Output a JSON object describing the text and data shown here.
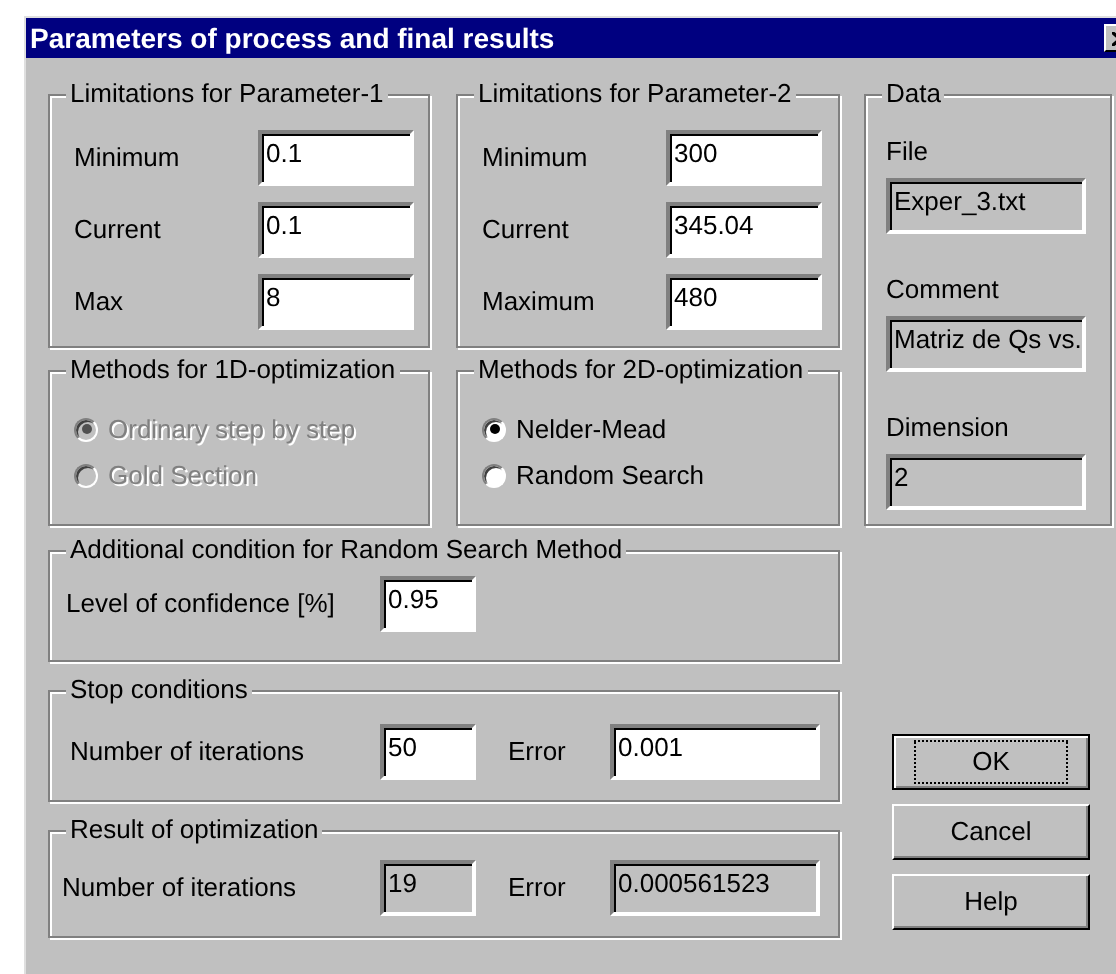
{
  "window": {
    "title": "Parameters of process and final results"
  },
  "parameter_1": {
    "title": "Limitations for Parameter-1",
    "fields": [
      {
        "label": "Minimum",
        "value": "0.1"
      },
      {
        "label": "Current",
        "value": "0.1"
      },
      {
        "label": "Max",
        "value": "8"
      }
    ]
  },
  "parameter_2": {
    "title": "Limitations for Parameter-2",
    "fields": [
      {
        "label": "Minimum",
        "value": "300"
      },
      {
        "label": "Current",
        "value": "345.04"
      },
      {
        "label": "Maximum",
        "value": "480"
      }
    ]
  },
  "data": {
    "title": "Data",
    "read_only": true,
    "fields": [
      {
        "label": "File",
        "value": "Exper_3.txt"
      },
      {
        "label": "Comment",
        "value": "Matriz de Qs vs."
      },
      {
        "label": "Dimension",
        "value": "2"
      }
    ]
  },
  "methods_1d": {
    "title": "Methods for 1D-optimization",
    "disabled": true,
    "options": [
      {
        "label": "Ordinary step by step",
        "selected": true
      },
      {
        "label": "Gold Section",
        "selected": false
      }
    ]
  },
  "methods_2d": {
    "title": "Methods for 2D-optimization",
    "disabled": false,
    "options": [
      {
        "label": "Nelder-Mead",
        "selected": true
      },
      {
        "label": "Random Search",
        "selected": false
      }
    ]
  },
  "additional_condition": {
    "title": "Additional condition for Random Search Method",
    "read_only": false,
    "fields": [
      {
        "label": "Level of confidence [%]",
        "value": "0.95"
      }
    ]
  },
  "stop_conditions": {
    "title": "Stop conditions",
    "read_only": false,
    "fields": [
      {
        "label": "Number of iterations",
        "value": "50"
      },
      {
        "label": "Error",
        "value": "0.001"
      }
    ]
  },
  "result": {
    "title": "Result of optimization",
    "read_only": true,
    "fields": [
      {
        "label": "Number of iterations",
        "value": "19"
      },
      {
        "label": "Error",
        "value": "0.000561523"
      }
    ]
  },
  "buttons": [
    {
      "label": "OK",
      "focused": true
    },
    {
      "label": "Cancel",
      "focused": false
    },
    {
      "label": "Help",
      "focused": false
    }
  ]
}
